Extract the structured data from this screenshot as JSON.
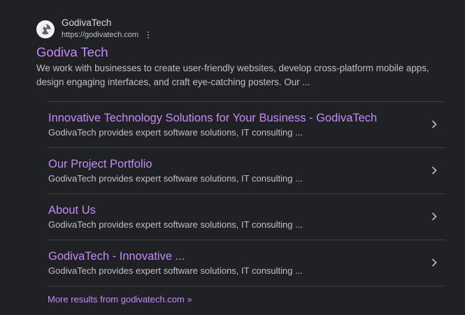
{
  "site": {
    "icon": "globe-icon",
    "name": "GodivaTech",
    "url": "https://godivatech.com"
  },
  "result": {
    "title": "Godiva Tech",
    "snippet": "We work with businesses to create user-friendly websites, develop cross-platform mobile apps, design engaging interfaces, and craft eye-catching posters. Our ..."
  },
  "sitelinks": [
    {
      "title": "Innovative Technology Solutions for Your Business - GodivaTech",
      "description": "GodivaTech provides expert software solutions, IT consulting ..."
    },
    {
      "title": "Our Project Portfolio",
      "description": "GodivaTech provides expert software solutions, IT consulting ..."
    },
    {
      "title": "About Us",
      "description": "GodivaTech provides expert software solutions, IT consulting ..."
    },
    {
      "title": "GodivaTech - Innovative ...",
      "description": "GodivaTech provides expert software solutions, IT consulting ..."
    }
  ],
  "more_results": "More results from godivatech.com »",
  "colors": {
    "background": "#202124",
    "link": "#c58af9",
    "text": "#bdc1c6",
    "divider": "#3c4043"
  }
}
